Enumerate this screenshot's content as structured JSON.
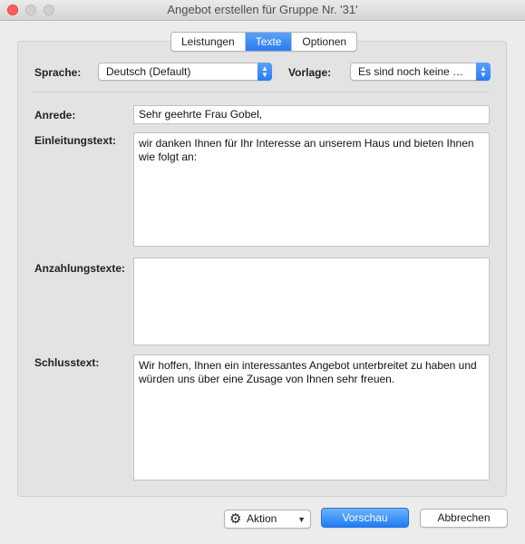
{
  "window": {
    "title": "Angebot erstellen für Gruppe Nr. '31'"
  },
  "tabs": [
    {
      "label": "Leistungen",
      "active": false
    },
    {
      "label": "Texte",
      "active": true
    },
    {
      "label": "Optionen",
      "active": false
    }
  ],
  "language": {
    "label": "Sprache:",
    "value": "Deutsch (Default)"
  },
  "template": {
    "label": "Vorlage:",
    "value": "Es sind noch keine Vorlagen vorhanden"
  },
  "salutation": {
    "label": "Anrede:",
    "value": "Sehr geehrte Frau Gobel,"
  },
  "intro": {
    "label": "Einleitungstext:",
    "value": "wir danken Ihnen für Ihr Interesse an unserem Haus und bieten Ihnen wie folgt an:"
  },
  "deposit": {
    "label": "Anzahlungstexte:",
    "value": ""
  },
  "closing": {
    "label": "Schlusstext:",
    "value": "Wir hoffen, Ihnen ein interessantes Angebot unterbreitet zu haben und würden uns über eine Zusage von Ihnen sehr freuen."
  },
  "buttons": {
    "action": "Aktion",
    "preview": "Vorschau",
    "cancel": "Abbrechen"
  },
  "colors": {
    "accent": "#2a7cf2",
    "close": "#fc605b"
  }
}
